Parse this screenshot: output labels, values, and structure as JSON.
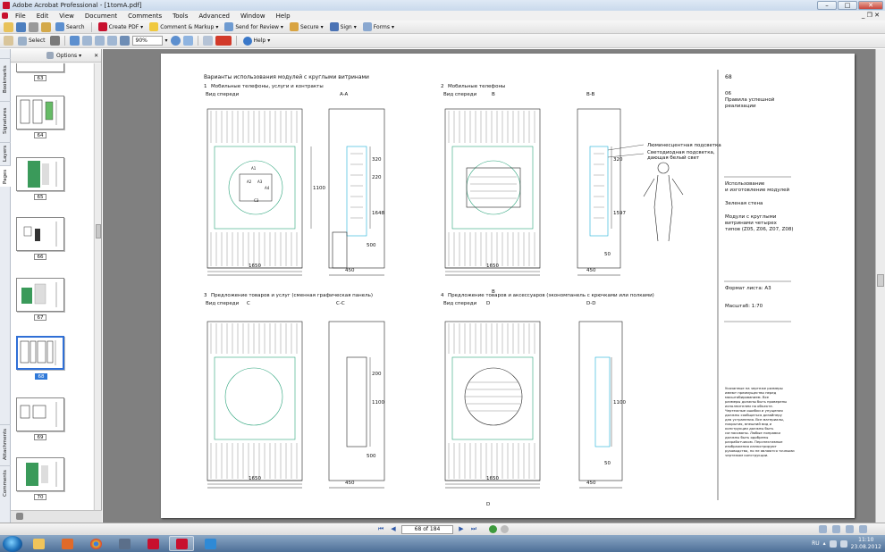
{
  "window": {
    "title": "Adobe Acrobat Professional - [1tomA.pdf]",
    "min": "–",
    "max": "□",
    "close": "✕",
    "doc_close": "_ ❐ ✕"
  },
  "menu": [
    "File",
    "Edit",
    "View",
    "Document",
    "Comments",
    "Tools",
    "Advanced",
    "Window",
    "Help"
  ],
  "toolbar1": {
    "search": "Search",
    "create_pdf": "Create PDF",
    "comment": "Comment & Markup",
    "send": "Send for Review",
    "secure": "Secure",
    "sign": "Sign",
    "forms": "Forms"
  },
  "toolbar2": {
    "select": "Select",
    "zoom": "90%",
    "help": "Help"
  },
  "panel": {
    "options": "Options",
    "close": "✕",
    "tabs": [
      "Bookmarks",
      "Signatures",
      "Layers",
      "Pages",
      "Attachments",
      "Comments"
    ],
    "pages": [
      "63",
      "64",
      "65",
      "66",
      "67",
      "68",
      "69",
      "70"
    ]
  },
  "nav": {
    "page_box": "68 of 184"
  },
  "drawing": {
    "heading": "Варианты использования модулей с круглыми витринами",
    "s1": "Мобильные телефоны, услуги и контракты",
    "s2": "Мобильные телефоны",
    "s3": "Предложение товаров и услуг (сменная графическая панель)",
    "s4": "Предложение товаров и аксессуаров (экономпанель с крючками или полками)",
    "n1": "1",
    "n2": "2",
    "n3": "3",
    "n4": "4",
    "front": "Вид спереди",
    "aa": "A-A",
    "bb": "B-B",
    "cc": "C-C",
    "dd": "D-D",
    "A": "A",
    "B": "B",
    "C": "C",
    "D": "D",
    "d1650": "1650",
    "d450": "450",
    "d1100": "1100",
    "d1648": "1648",
    "d1597": "1597",
    "d500": "500",
    "d50": "50",
    "d320": "320",
    "d220": "220",
    "d200": "200",
    "lbl_led1": "Люминесцентная подсветка",
    "lbl_led2": "Светодиодная подсветка,",
    "lbl_led3": "дающая белый свет",
    "sh1": "A1",
    "sh2": "A2",
    "sh3": "A3",
    "sh4": "A4",
    "sh5": "C3"
  },
  "sidebar": {
    "page_no": "68",
    "sec_no": "06",
    "sec1": "Правила успешной",
    "sec2": "реализации",
    "t1": "Использование",
    "t2": "и изготовление модулей",
    "t3": "Зеленая стена",
    "t4": "Модули с круглыми",
    "t5": "витринами четырех",
    "t6": "типов (Z05, Z06, Z07, Z08)",
    "fmt": "Формат листа: А3",
    "scale": "Масштаб: 1:70",
    "note": [
      "Указанные на чертеже размеры",
      "имеют преимущество перед",
      "масштабированием. Все",
      "размеры должны быть проверены",
      "исполнителем на объекте.",
      "Чертежные ошибки и упущения",
      "должны сообщаться дизайнеру",
      "для устранения. Все материалы,",
      "покрытия, внешний вид и",
      "конструкции должны быть",
      "согласованы. Любые поправки",
      "должны быть одобрены",
      "разработчиком. Перспективные",
      "изображения иллюстрируют",
      "руководство, но не являются точными",
      "чертежом конструкции."
    ]
  },
  "taskbar": {
    "lang": "RU",
    "time": "11:10",
    "date": "23.08.2012"
  },
  "colors": {
    "accent": "#3079d8",
    "drawing_line": "#222222",
    "teal": "#2aa37a",
    "cyan": "#19b0d8"
  }
}
